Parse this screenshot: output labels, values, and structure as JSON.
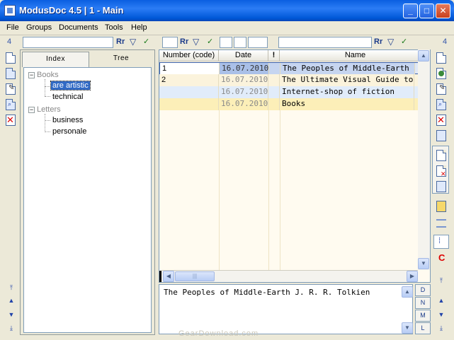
{
  "window": {
    "title": "ModusDoc 4.5 | 1 - Main"
  },
  "menu": [
    "File",
    "Groups",
    "Documents",
    "Tools",
    "Help"
  ],
  "filter": {
    "left_count": "4",
    "right_count": "4",
    "case_symbol": "Rr",
    "funnel_icon": "filter-icon",
    "apply_icon": "check-icon"
  },
  "left_panel": {
    "tabs": [
      "Index",
      "Tree"
    ],
    "tree": [
      {
        "label": "Books",
        "children": [
          "are artistic",
          "technical"
        ]
      },
      {
        "label": "Letters",
        "children": [
          "business",
          "personale"
        ]
      }
    ]
  },
  "grid": {
    "columns": [
      "Number (code)",
      "Date",
      "!",
      "Name"
    ],
    "rows": [
      {
        "number": "1",
        "date": "16.07.2010",
        "flag": "",
        "name": "The Peoples of Middle-Earth  J. R"
      },
      {
        "number": "2",
        "date": "16.07.2010",
        "flag": "",
        "name": "The Ultimate Visual Guide to Star"
      },
      {
        "number": "",
        "date": "16.07.2010",
        "flag": "",
        "name": "Internet-shop of fiction"
      },
      {
        "number": "",
        "date": "16.07.2010",
        "flag": "",
        "name": "Books"
      }
    ]
  },
  "memo": {
    "text": "The Peoples of Middle-Earth  J. R. R. Tolkien",
    "tabs": [
      "D",
      "N",
      "M",
      "L"
    ]
  },
  "right_toolbar": {
    "c_label": "C"
  },
  "watermark": "GearDownload.com"
}
